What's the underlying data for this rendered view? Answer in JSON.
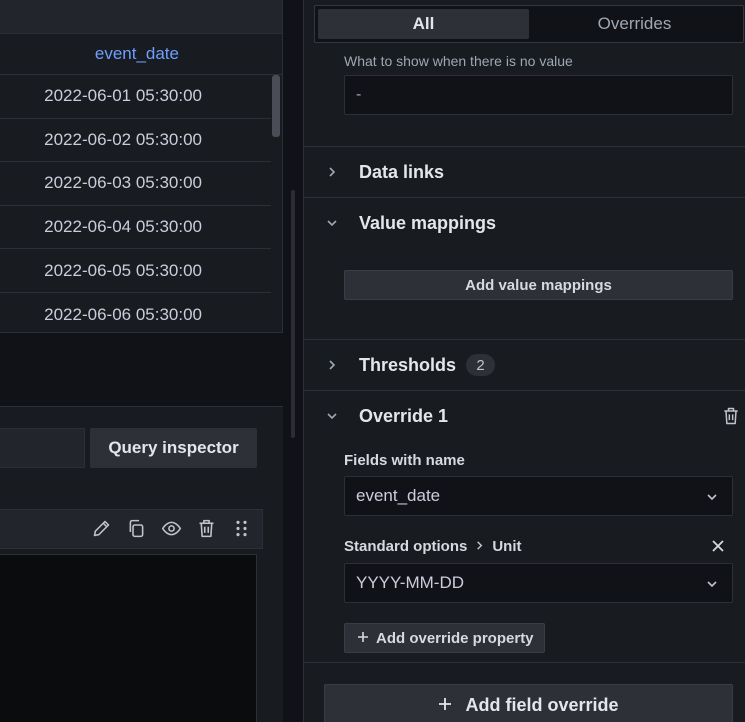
{
  "table": {
    "column_header": "event_date",
    "rows": [
      "2022-06-01 05:30:00",
      "2022-06-02 05:30:00",
      "2022-06-03 05:30:00",
      "2022-06-04 05:30:00",
      "2022-06-05 05:30:00",
      "2022-06-06 05:30:00"
    ]
  },
  "query": {
    "inspector_label": "Query inspector",
    "row_icons": [
      "pencil-icon",
      "copy-icon",
      "eye-icon",
      "trash-icon",
      "drag-handle-icon"
    ]
  },
  "options_pane": {
    "tabs": [
      "All",
      "Overrides"
    ],
    "active_tab": "All",
    "no_value": {
      "label": "What to show when there is no value",
      "value": "-"
    },
    "sections": {
      "data_links": {
        "title": "Data links",
        "expanded": false
      },
      "value_mappings": {
        "title": "Value mappings",
        "expanded": true,
        "button": "Add value mappings"
      },
      "thresholds": {
        "title": "Thresholds",
        "count": "2",
        "expanded": false
      },
      "override": {
        "title": "Override 1",
        "matcher_label": "Fields with name",
        "matcher_value": "event_date",
        "property_category": "Standard options",
        "property_name": "Unit",
        "property_value": "YYYY-MM-DD",
        "add_property": "Add override property"
      }
    },
    "add_field_override": "Add field override"
  },
  "colors": {
    "accent_link": "#6e9fff",
    "background": "#111217",
    "panel": "#181b1f",
    "button": "#2d3037"
  }
}
